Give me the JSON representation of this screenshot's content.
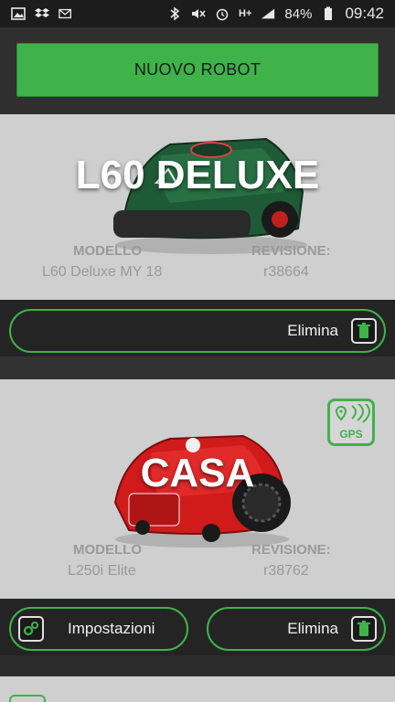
{
  "status_bar": {
    "battery": "84%",
    "time": "09:42",
    "network": "H+"
  },
  "header": {
    "new_robot_label": "NUOVO ROBOT"
  },
  "robots": [
    {
      "name": "L60 DELUXE",
      "model_label": "MODELLO",
      "model_value": "L60 Deluxe MY 18",
      "revision_label": "REVISIONE:",
      "revision_value": "r38664",
      "delete_label": "Elimina",
      "mower_color": "#1f5a36"
    },
    {
      "name": "CASA",
      "model_label": "MODELLO",
      "model_value": "L250i Elite",
      "revision_label": "REVISIONE:",
      "revision_value": "r38762",
      "settings_label": "Impostazioni",
      "delete_label": "Elimina",
      "gps_badge": "GPS",
      "mower_color": "#d11b1b"
    }
  ],
  "accent_color": "#3fb24a"
}
